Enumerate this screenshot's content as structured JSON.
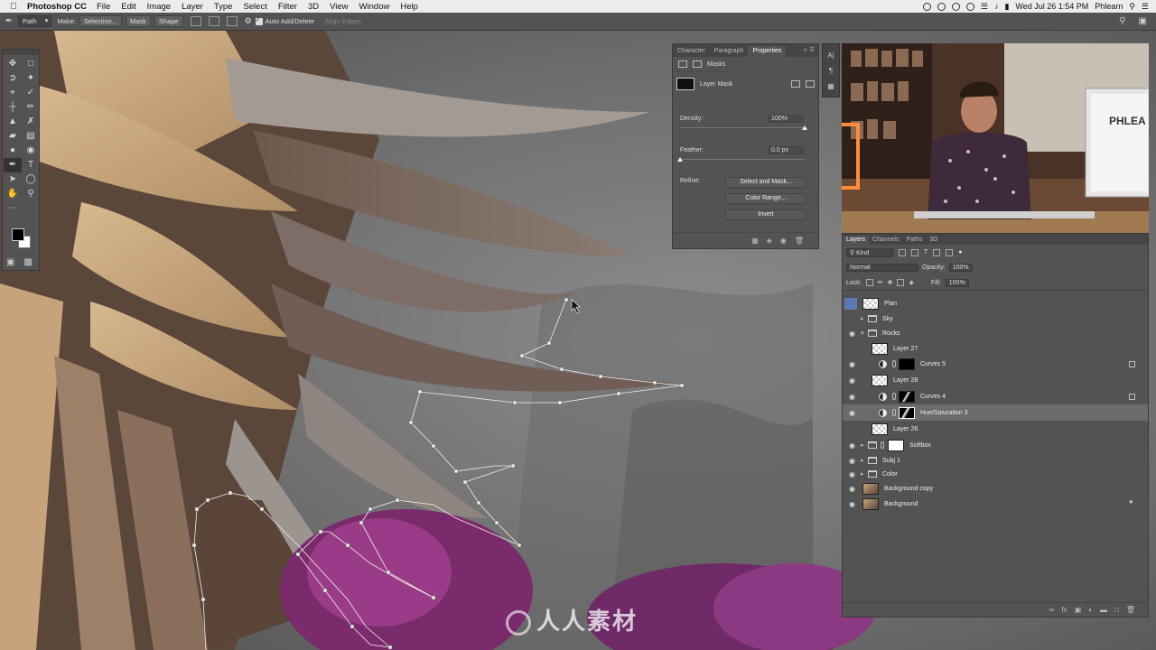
{
  "menubar": {
    "app_name": "Photoshop CC",
    "items": [
      "File",
      "Edit",
      "Image",
      "Layer",
      "Type",
      "Select",
      "Filter",
      "3D",
      "View",
      "Window",
      "Help"
    ],
    "datetime": "Wed Jul 26  1:54 PM",
    "user": "Phlearn"
  },
  "optionsbar": {
    "mode": "Path",
    "make_label": "Make:",
    "selection_label": "Selection...",
    "mask_label": "Mask",
    "shape_label": "Shape",
    "auto_add_delete": "Auto Add/Delete",
    "align_edges": "Align Edges"
  },
  "properties": {
    "tabs": [
      "Character",
      "Paragraph",
      "Properties"
    ],
    "section": "Masks",
    "mask_type": "Layer Mask",
    "density_label": "Density:",
    "density_value": "100%",
    "density_fraction": 1.0,
    "feather_label": "Feather:",
    "feather_value": "0.0 px",
    "feather_fraction": 0.0,
    "refine_label": "Refine:",
    "buttons": [
      "Select and Mask...",
      "Color Range...",
      "Invert"
    ]
  },
  "layers_panel": {
    "tabs": [
      "Layers",
      "Channels",
      "Paths",
      "3D"
    ],
    "kind_label": "Kind",
    "blend_mode": "Normal",
    "opacity_label": "Opacity:",
    "opacity_value": "100%",
    "lock_label": "Lock:",
    "fill_label": "Fill:",
    "fill_value": "100%",
    "layers": [
      {
        "name": "Plan"
      },
      {
        "name": "Sky"
      },
      {
        "name": "Rocks"
      },
      {
        "name": "Layer 27"
      },
      {
        "name": "Curves 5"
      },
      {
        "name": "Layer 28"
      },
      {
        "name": "Curves 4"
      },
      {
        "name": "Hue/Saturation 3"
      },
      {
        "name": "Layer 26"
      },
      {
        "name": "Softbox"
      },
      {
        "name": "Subj 1"
      },
      {
        "name": "Color"
      },
      {
        "name": "Background copy"
      },
      {
        "name": "Background"
      }
    ]
  },
  "video": {
    "sign_text": "PHLEA"
  },
  "watermark": {
    "text": "人人素材"
  },
  "colors": {
    "panel_bg": "#535353",
    "panel_dark": "#454545",
    "selected_row": "#6b6b6b",
    "accent_blue": "#5a7ab5"
  }
}
